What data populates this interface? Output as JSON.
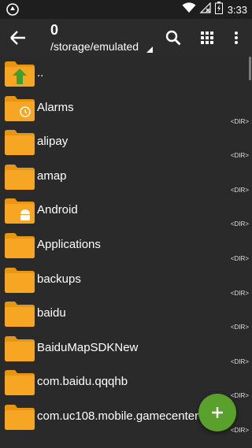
{
  "status": {
    "time": "3:33"
  },
  "toolbar": {
    "title": "0",
    "path": "/storage/emulated"
  },
  "rows": [
    {
      "name": "..",
      "dir": "",
      "overlay": "up-arrow"
    },
    {
      "name": "Alarms",
      "dir": "<DIR>",
      "overlay": "alarm-clock"
    },
    {
      "name": "alipay",
      "dir": "<DIR>",
      "overlay": ""
    },
    {
      "name": "amap",
      "dir": "<DIR>",
      "overlay": ""
    },
    {
      "name": "Android",
      "dir": "<DIR>",
      "overlay": "android"
    },
    {
      "name": "Applications",
      "dir": "<DIR>",
      "overlay": ""
    },
    {
      "name": "backups",
      "dir": "<DIR>",
      "overlay": ""
    },
    {
      "name": "baidu",
      "dir": "<DIR>",
      "overlay": ""
    },
    {
      "name": "BaiduMapSDKNew",
      "dir": "<DIR>",
      "overlay": ""
    },
    {
      "name": "com.baidu.qqqhb",
      "dir": "<DIR>",
      "overlay": ""
    },
    {
      "name": "com.uc108.mobile.gamecenter",
      "dir": "<DIR>",
      "overlay": ""
    }
  ],
  "colors": {
    "folder": "#f6a623",
    "folder_dark": "#e89512",
    "fab": "#5aa02c",
    "background": "#2a2a2a"
  },
  "icons": {
    "back": "arrow-left-icon",
    "search": "search-icon",
    "grid": "grid-view-icon",
    "more": "more-vert-icon",
    "fab": "plus-icon"
  }
}
